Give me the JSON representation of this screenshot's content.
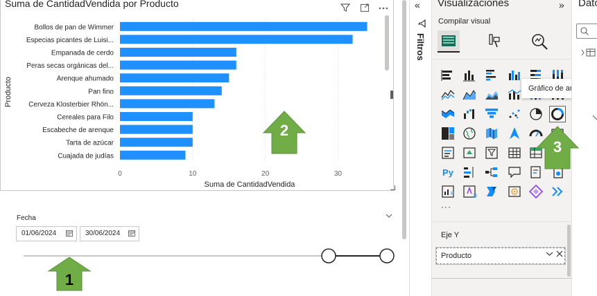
{
  "chart": {
    "title": "Suma de CantidadVendida por Producto",
    "icons": [
      "filter-icon",
      "focus-mode-icon",
      "more-options-icon"
    ]
  },
  "chart_data": {
    "type": "bar",
    "orientation": "horizontal",
    "title": "Suma de CantidadVendida por Producto",
    "xlabel": "Suma de CantidadVendida",
    "ylabel": "Producto",
    "categories": [
      "Bollos de pan de Wimmer",
      "Especias picantes de Luisi...",
      "Empanada de cerdo",
      "Peras secas orgánicas del...",
      "Arenque ahumado",
      "Pan fino",
      "Cerveza Klosterbier Rhön...",
      "Cereales para Filo",
      "Escabeche de arenque",
      "Tarta de azúcar",
      "Cuajada de judías"
    ],
    "values": [
      34,
      32,
      16,
      16,
      15,
      14,
      13,
      10,
      10,
      10,
      9
    ],
    "xlim": [
      0,
      35
    ],
    "xticks": [
      0,
      10,
      20,
      30
    ],
    "grid": true,
    "bar_color": "#1e90ff"
  },
  "slicer": {
    "label": "Fecha",
    "date_from": "01/06/2024",
    "date_to": "30/06/2024"
  },
  "filters_pane": {
    "label": "Filtros",
    "collapse_glyph": "«"
  },
  "viz_pane": {
    "title": "Visualizaciones",
    "collapse_glyph": "»",
    "build_label": "Compilar visual",
    "tooltip": "Gráfico de anillos",
    "more_label": "···",
    "axis_label": "Eje Y",
    "field": "Producto",
    "gallery_icons": [
      "stacked-bar-chart-icon",
      "stacked-column-chart-icon",
      "clustered-bar-chart-icon",
      "clustered-column-chart-icon",
      "100-percent-bar-chart-icon",
      "100-percent-column-chart-icon",
      "line-chart-icon",
      "area-chart-icon",
      "stacked-area-chart-icon",
      "line-clustered-column-icon",
      "line-stacked-column-icon",
      "ribbon-chart-icon",
      "ribbon-chart-alt-icon",
      "waterfall-chart-icon",
      "funnel-chart-icon",
      "scatter-chart-icon",
      "pie-chart-icon",
      "donut-chart-icon",
      "treemap-icon",
      "map-icon",
      "filled-map-icon",
      "azure-map-icon",
      "gauge-icon",
      "card-icon",
      "multi-row-card-icon",
      "kpi-icon",
      "slicer-icon",
      "table-icon",
      "matrix-icon",
      "decomposition-tree-icon",
      "python-visual-icon",
      "key-influencers-icon",
      "decomposition-icon",
      "qa-icon",
      "smart-narrative-icon",
      "paginated-report-icon",
      "r-visual-icon",
      "powerapps-icon",
      "power-automate-icon",
      "goals-icon",
      "diamond-icon",
      "chevron-icon"
    ],
    "accent": "#118dff"
  },
  "data_pane": {
    "title": "Datos"
  },
  "annotations": [
    {
      "label": "1",
      "color": "#70ad47"
    },
    {
      "label": "2",
      "color": "#70ad47"
    },
    {
      "label": "3",
      "color": "#70ad47"
    }
  ]
}
